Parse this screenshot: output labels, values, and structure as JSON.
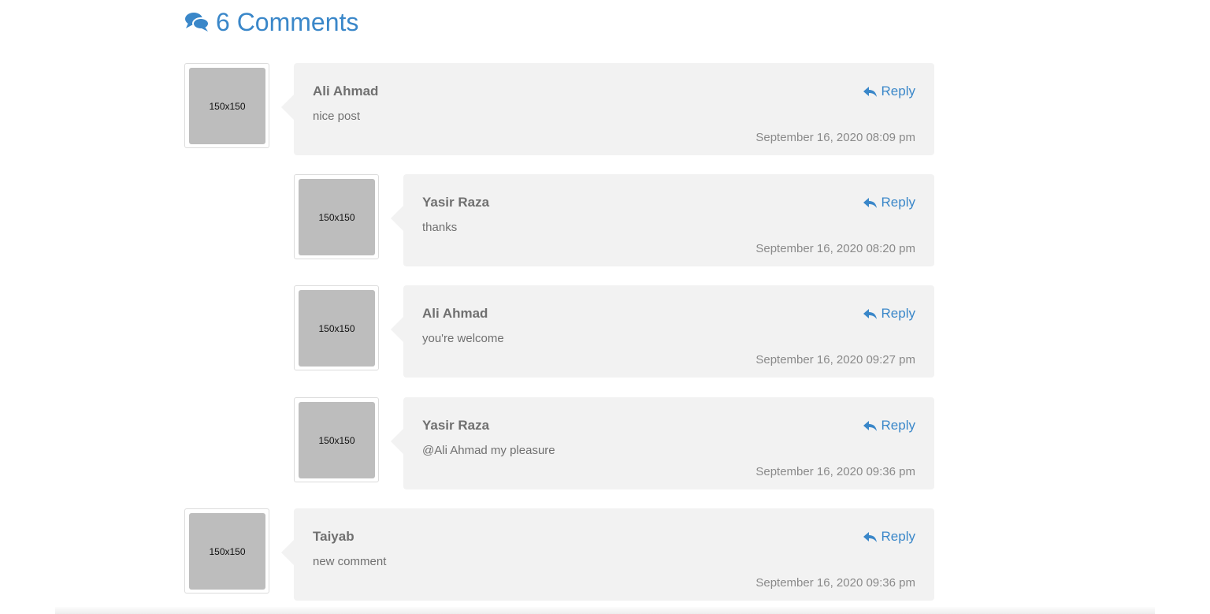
{
  "comments_header": {
    "title": "6 Comments",
    "icon": "comments-icon",
    "color": "#3a87c9"
  },
  "comments": [
    {
      "avatar_text": "150x150",
      "author": "Ali Ahmad",
      "text": "nice post",
      "date": "September 16, 2020 08:09 pm",
      "reply_label": "Reply"
    },
    {
      "avatar_text": "150x150",
      "author": "Yasir Raza",
      "text": "thanks",
      "date": "September 16, 2020 08:20 pm",
      "reply_label": "Reply"
    },
    {
      "avatar_text": "150x150",
      "author": "Ali Ahmad",
      "text": "you're welcome",
      "date": "September 16, 2020 09:27 pm",
      "reply_label": "Reply"
    },
    {
      "avatar_text": "150x150",
      "author": "Yasir Raza",
      "text": "@Ali Ahmad my pleasure",
      "date": "September 16, 2020 09:36 pm",
      "reply_label": "Reply"
    },
    {
      "avatar_text": "150x150",
      "author": "Taiyab",
      "text": "new comment",
      "date": "September 16, 2020 09:36 pm",
      "reply_label": "Reply"
    }
  ]
}
